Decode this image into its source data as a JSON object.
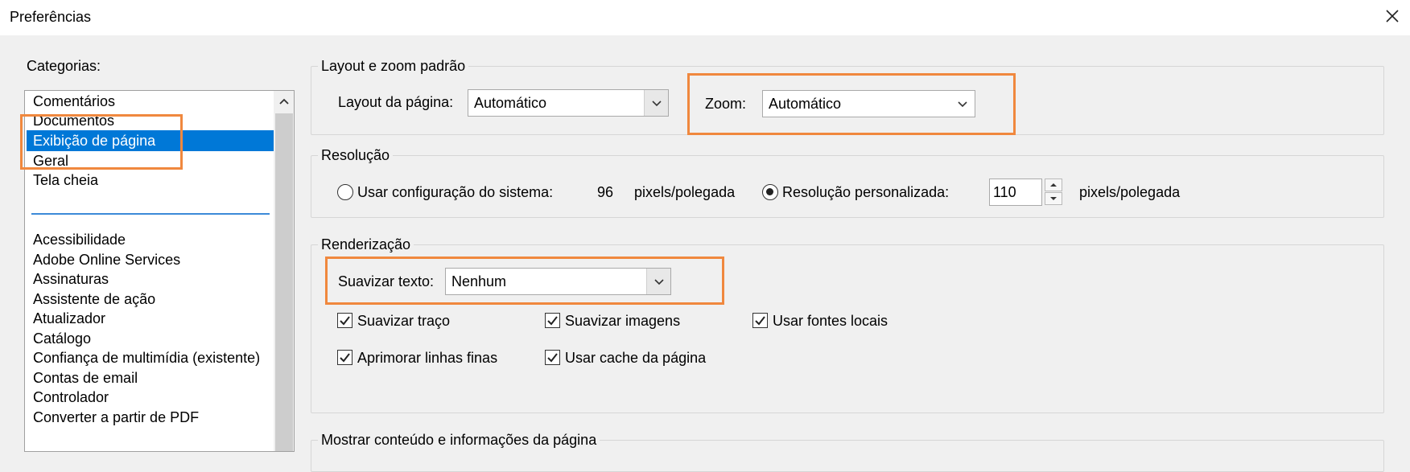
{
  "window": {
    "title": "Preferências"
  },
  "categories": {
    "label": "Categorias:",
    "group1": [
      "Comentários",
      "Documentos",
      "Exibição de página",
      "Geral",
      "Tela cheia"
    ],
    "group2": [
      "Acessibilidade",
      "Adobe Online Services",
      "Assinaturas",
      "Assistente de ação",
      "Atualizador",
      "Catálogo",
      "Confiança de multimídia (existente)",
      "Contas de email",
      "Controlador",
      "Converter a partir de PDF"
    ],
    "selected": "Exibição de página"
  },
  "layout_zoom": {
    "title": "Layout e zoom padrão",
    "page_layout_label": "Layout da página:",
    "page_layout_value": "Automático",
    "zoom_label": "Zoom:",
    "zoom_value": "Automático"
  },
  "resolution": {
    "title": "Resolução",
    "system_label": "Usar configuração do sistema:",
    "system_value": "96",
    "system_unit": "pixels/polegada",
    "custom_label": "Resolução personalizada:",
    "custom_value": "110",
    "custom_unit": "pixels/polegada",
    "selected": "custom"
  },
  "rendering": {
    "title": "Renderização",
    "smooth_text_label": "Suavizar texto:",
    "smooth_text_value": "Nenhum",
    "checkboxes": [
      {
        "label": "Suavizar traço",
        "checked": true
      },
      {
        "label": "Suavizar imagens",
        "checked": true
      },
      {
        "label": "Usar fontes locais",
        "checked": true
      },
      {
        "label": "Aprimorar linhas finas",
        "checked": true
      },
      {
        "label": "Usar cache da página",
        "checked": true
      }
    ]
  },
  "page_content": {
    "title": "Mostrar conteúdo e informações da página"
  },
  "colors": {
    "selection": "#0078d7",
    "highlight": "#f0883e",
    "separator": "#3c8ad8"
  }
}
